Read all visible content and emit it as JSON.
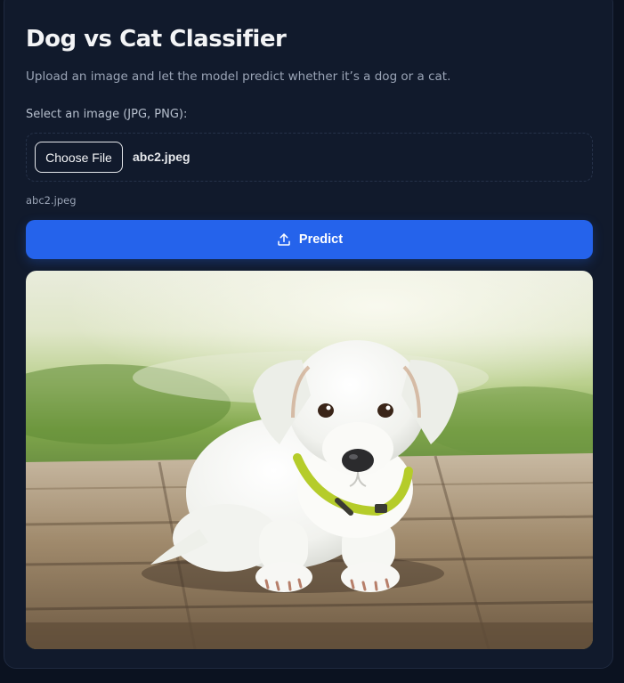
{
  "app": {
    "title": "Dog vs Cat Classifier",
    "subtitle": "Upload an image and let the model predict whether it’s a dog or a cat."
  },
  "upload": {
    "label": "Select an image (JPG, PNG):",
    "choose_button": "Choose File",
    "selected_file": "abc2.jpeg",
    "file_caption": "abc2.jpeg"
  },
  "actions": {
    "predict_label": "Predict",
    "predict_icon": "upload-icon"
  },
  "preview": {
    "image_icon": "image-preview"
  },
  "colors": {
    "background": "#0b1220",
    "card": "#111a2c",
    "accent": "#2563eb"
  }
}
